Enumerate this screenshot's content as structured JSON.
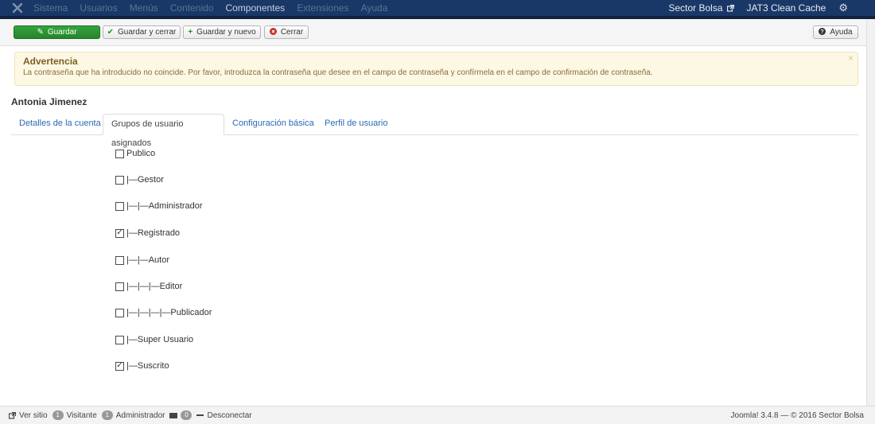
{
  "topnav": {
    "menu": [
      "Sistema",
      "Usuarios",
      "Menús",
      "Contenido",
      "Componentes",
      "Extensiones",
      "Ayuda"
    ],
    "site_name": "Sector Bolsa",
    "cache_label": "JAT3 Clean Cache"
  },
  "toolbar": {
    "save": "Guardar",
    "save_close": "Guardar y cerrar",
    "save_new": "Guardar y nuevo",
    "close": "Cerrar",
    "help": "Ayuda"
  },
  "alert": {
    "title": "Advertencia",
    "message": "La contraseña que ha introducido no coincide. Por favor, introduzca la contraseña que desee en el campo de contraseña y confírmela en el campo de confirmación de contraseña.",
    "close": "×"
  },
  "user": {
    "name": "Antonia Jimenez"
  },
  "tabs": [
    "Detalles de la cuenta",
    "Grupos de usuario asignados",
    "Configuración básica",
    "Perfil de usuario"
  ],
  "groups": [
    {
      "label": "Publico",
      "checked": false
    },
    {
      "label": "|—Gestor",
      "checked": false
    },
    {
      "label": "|—|—Administrador",
      "checked": false
    },
    {
      "label": "|—Registrado",
      "checked": true
    },
    {
      "label": "|—|—Autor",
      "checked": false
    },
    {
      "label": "|—|—|—Editor",
      "checked": false
    },
    {
      "label": "|—|—|—|—Publicador",
      "checked": false
    },
    {
      "label": "|—Super Usuario",
      "checked": false
    },
    {
      "label": "|—Suscrito",
      "checked": true
    }
  ],
  "footer": {
    "view_site": "Ver sitio",
    "visitors_count": "1",
    "visitors_label": "Visitante",
    "admins_count": "1",
    "admins_label": "Administrador",
    "messages_count": "0",
    "logout": "Desconectar",
    "version": "Joomla! 3.4.8 — © 2016 Sector Bolsa"
  },
  "colors": {
    "nav_bg": "#1a3867",
    "primary_button": "#2c962f",
    "alert_bg": "#fcf8e3",
    "link": "#2a69b8"
  },
  "icons": [
    "joomla-logo-icon",
    "external-link-icon",
    "gear-icon",
    "edit-icon",
    "check-icon",
    "plus-icon",
    "close-circle-icon",
    "question-circle-icon",
    "mail-icon",
    "minus-icon"
  ]
}
